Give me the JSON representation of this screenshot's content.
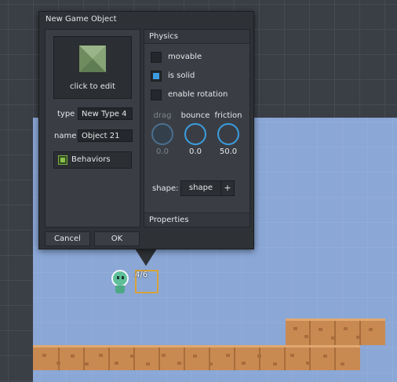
{
  "dialog": {
    "title": "New Game Object",
    "thumbnail_label": "click to edit",
    "type_label": "type",
    "type_value": "New Type 4",
    "name_label": "name",
    "name_value": "Object 21",
    "behaviors_label": "Behaviors",
    "cancel_label": "Cancel",
    "ok_label": "OK"
  },
  "physics": {
    "header": "Physics",
    "checkboxes": [
      {
        "label": "movable",
        "checked": false
      },
      {
        "label": "is solid",
        "checked": true
      },
      {
        "label": "enable rotation",
        "checked": false
      }
    ],
    "knobs": [
      {
        "label": "drag",
        "value": "0.0",
        "enabled": false
      },
      {
        "label": "bounce",
        "value": "0.0",
        "enabled": true
      },
      {
        "label": "friction",
        "value": "50.0",
        "enabled": true
      }
    ],
    "shape_label": "shape:",
    "shape_value": "shape",
    "shape_add": "+"
  },
  "properties": {
    "header": "Properties"
  },
  "scene": {
    "counter": "4/6"
  },
  "colors": {
    "accent": "#3b9de0",
    "dialog_bg": "#2e3135",
    "panel_bg": "#3a3e44",
    "water": "#8aa7d6",
    "ground": "#c98a52",
    "selection": "#d8a23a"
  }
}
